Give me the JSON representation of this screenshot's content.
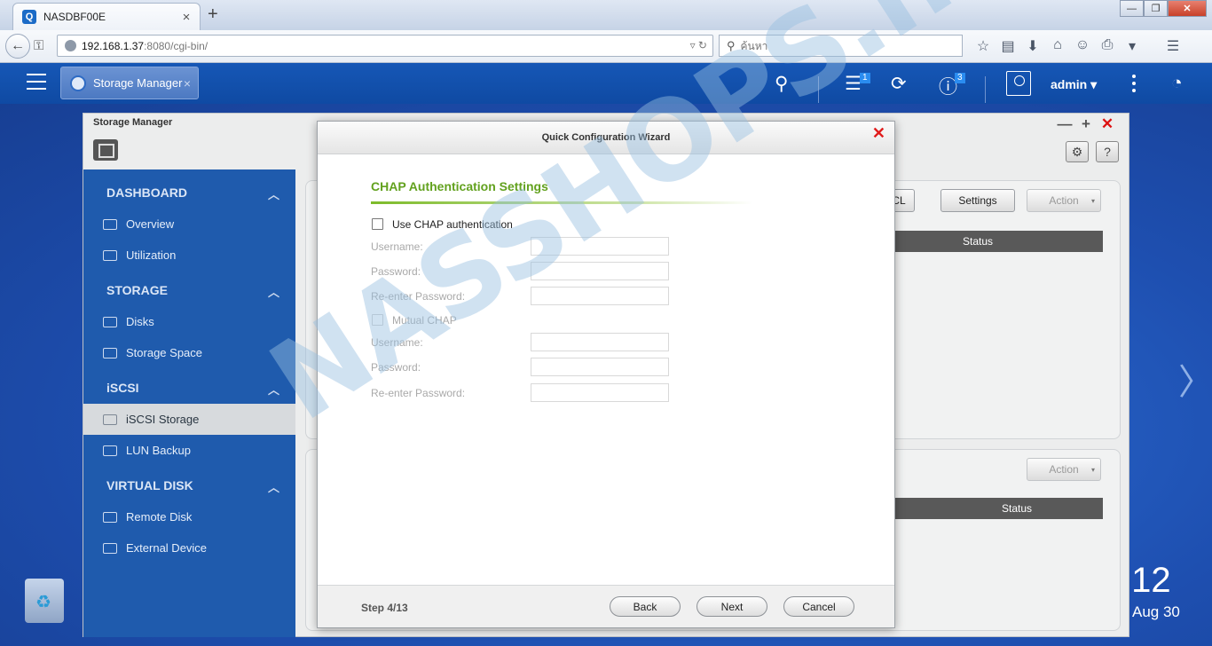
{
  "browser": {
    "tab_title": "NASDBF00E",
    "favicon_letter": "Q",
    "tab_close": "×",
    "new_tab": "+",
    "url_host": "192.168.1.37",
    "url_rest": ":8080/cgi-bin/",
    "search_placeholder": "ค้นหา",
    "window_controls": [
      "—",
      "❐",
      "✕"
    ]
  },
  "topbar": {
    "app_tab_label": "Storage Manager",
    "app_tab_close": "×",
    "tasks_badge": "1",
    "info_badge": "3",
    "user": "admin ▾"
  },
  "window": {
    "title": "Storage Manager",
    "controls": [
      "—",
      "+",
      "✕"
    ],
    "settings_icon": "⚙",
    "help_icon": "?"
  },
  "sidebar": {
    "sections": [
      {
        "title": "DASHBOARD",
        "items": [
          "Overview",
          "Utilization"
        ]
      },
      {
        "title": "STORAGE",
        "items": [
          "Disks",
          "Storage Space"
        ]
      },
      {
        "title": "iSCSI",
        "items": [
          "iSCSI Storage",
          "LUN Backup"
        ]
      },
      {
        "title": "VIRTUAL DISK",
        "items": [
          "Remote Disk",
          "External Device"
        ]
      }
    ],
    "chevron": "︿",
    "active_item": "iSCSI Storage"
  },
  "background_panel": {
    "acl_button": "ACL",
    "settings_button": "Settings",
    "action_button": "Action",
    "status_header": "Status",
    "action_button_2": "Action",
    "status_header_2": "Status"
  },
  "wizard": {
    "title": "Quick Configuration Wizard",
    "close": "✕",
    "heading": "CHAP Authentication Settings",
    "use_chap_label": "Use CHAP authentication",
    "username_label": "Username:",
    "password_label": "Password:",
    "reenter_label": "Re-enter Password:",
    "mutual_chap_label": "Mutual CHAP",
    "mutual_username_label": "Username:",
    "mutual_password_label": "Password:",
    "mutual_reenter_label": "Re-enter Password:",
    "step": "Step 4/13",
    "back": "Back",
    "next": "Next",
    "cancel": "Cancel"
  },
  "desktop": {
    "clock": ":12",
    "date": "Aug 30",
    "next_arrow": "〉"
  },
  "watermark": "NASSHOPS.net",
  "colors": {
    "accent_green": "#62a11e",
    "sidebar_blue": "#1f5bad",
    "topbar_blue": "#1657b6",
    "close_red": "#e01b1b"
  }
}
